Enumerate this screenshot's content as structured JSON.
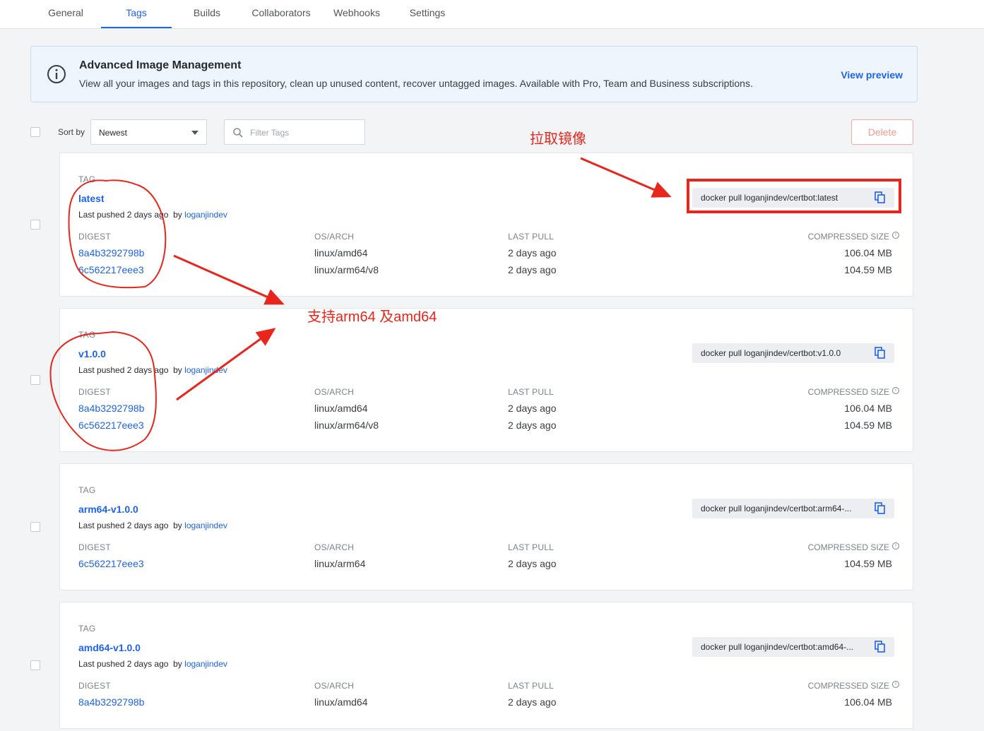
{
  "tabs": [
    {
      "label": "General"
    },
    {
      "label": "Tags"
    },
    {
      "label": "Builds"
    },
    {
      "label": "Collaborators"
    },
    {
      "label": "Webhooks"
    },
    {
      "label": "Settings"
    }
  ],
  "banner": {
    "title": "Advanced Image Management",
    "text": "View all your images and tags in this repository, clean up unused content, recover untagged images. Available with Pro, Team and Business subscriptions.",
    "link": "View preview"
  },
  "controls": {
    "sort_label": "Sort by",
    "sort_value": "Newest",
    "filter_placeholder": "Filter Tags",
    "delete_label": "Delete"
  },
  "columns": {
    "tag": "TAG",
    "digest": "DIGEST",
    "os_arch": "OS/ARCH",
    "last_pull": "LAST PULL",
    "size": "COMPRESSED SIZE"
  },
  "tags": [
    {
      "name": "latest",
      "pushed_prefix": "Last pushed",
      "pushed_when": "2 days ago",
      "pushed_by": "by",
      "user": "loganjindev",
      "pull_cmd": "docker pull loganjindev/certbot:latest",
      "rows": [
        {
          "digest": "8a4b3292798b",
          "arch": "linux/amd64",
          "last_pull": "2 days ago",
          "size": "106.04 MB"
        },
        {
          "digest": "6c562217eee3",
          "arch": "linux/arm64/v8",
          "last_pull": "2 days ago",
          "size": "104.59 MB"
        }
      ]
    },
    {
      "name": "v1.0.0",
      "pushed_prefix": "Last pushed",
      "pushed_when": "2 days ago",
      "pushed_by": "by",
      "user": "loganjindev",
      "pull_cmd": "docker pull loganjindev/certbot:v1.0.0",
      "rows": [
        {
          "digest": "8a4b3292798b",
          "arch": "linux/amd64",
          "last_pull": "2 days ago",
          "size": "106.04 MB"
        },
        {
          "digest": "6c562217eee3",
          "arch": "linux/arm64/v8",
          "last_pull": "2 days ago",
          "size": "104.59 MB"
        }
      ]
    },
    {
      "name": "arm64-v1.0.0",
      "pushed_prefix": "Last pushed",
      "pushed_when": "2 days ago",
      "pushed_by": "by",
      "user": "loganjindev",
      "pull_cmd": "docker pull loganjindev/certbot:arm64-...",
      "rows": [
        {
          "digest": "6c562217eee3",
          "arch": "linux/arm64",
          "last_pull": "2 days ago",
          "size": "104.59 MB"
        }
      ]
    },
    {
      "name": "amd64-v1.0.0",
      "pushed_prefix": "Last pushed",
      "pushed_when": "2 days ago",
      "pushed_by": "by",
      "user": "loganjindev",
      "pull_cmd": "docker pull loganjindev/certbot:amd64-...",
      "rows": [
        {
          "digest": "8a4b3292798b",
          "arch": "linux/amd64",
          "last_pull": "2 days ago",
          "size": "106.04 MB"
        }
      ]
    }
  ],
  "annotations": {
    "pull_image": "拉取镜像",
    "arch_support": "支持arm64 及amd64",
    "color": "#e8261c"
  }
}
